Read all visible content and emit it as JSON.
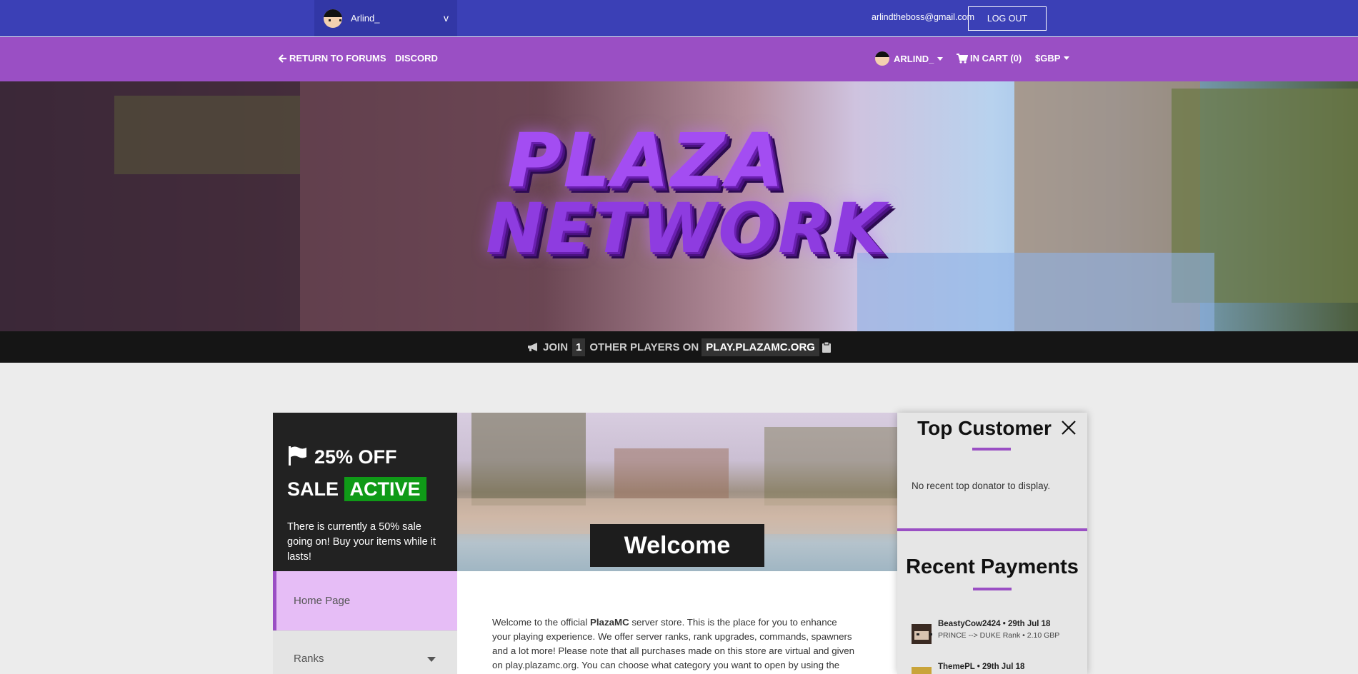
{
  "topbar": {
    "username": "Arlind_",
    "dropdown_caret": "v",
    "email": "arlindtheboss@gmail.com",
    "logout_label": "LOG OUT"
  },
  "navbar": {
    "return_label": "RETURN TO FORUMS",
    "discord_label": "DISCORD",
    "account_label": "ARLIND_",
    "cart_label": "IN CART (0)",
    "currency_label": "GBP"
  },
  "hero": {
    "logo_line1": "PLAZA",
    "logo_line2": "NETWORK"
  },
  "joinbar": {
    "prefix": "JOIN",
    "count": "1",
    "middle": "OTHER PLAYERS ON",
    "server_ip": "PLAY.PLAZAMC.ORG"
  },
  "sale": {
    "line1": "25% OFF",
    "line2": "SALE",
    "status": "ACTIVE",
    "description": "There is currently a 50% sale going on! Buy your items while it lasts!"
  },
  "welcome": {
    "label": "Welcome",
    "text_before": "Welcome to the official ",
    "brand": "PlazaMC",
    "text_after": " server store. This is the place for you to enhance your playing experience. We offer server ranks, rank upgrades, commands, spawners and a lot more! Please note that all purchases made on this store are virtual and given on play.plazamc.org. You can choose what category you want to open by using the navigation"
  },
  "sidebar": {
    "items": [
      {
        "label": "Home Page"
      },
      {
        "label": "Ranks"
      }
    ]
  },
  "top_customer": {
    "title": "Top Customer",
    "empty_message": "No recent top donator to display."
  },
  "recent_payments": {
    "title": "Recent Payments",
    "items": [
      {
        "header": "BeastyCow2424 • 29th Jul 18",
        "detail": "PRINCE --> DUKE Rank • 2.10 GBP"
      },
      {
        "header": "ThemePL • 29th Jul 18",
        "detail": ""
      }
    ]
  },
  "colors": {
    "topbar": "#3b40b6",
    "navbar": "#9a4fc4",
    "sale_active": "#0f9a17",
    "home_highlight": "#e6bdf6"
  }
}
